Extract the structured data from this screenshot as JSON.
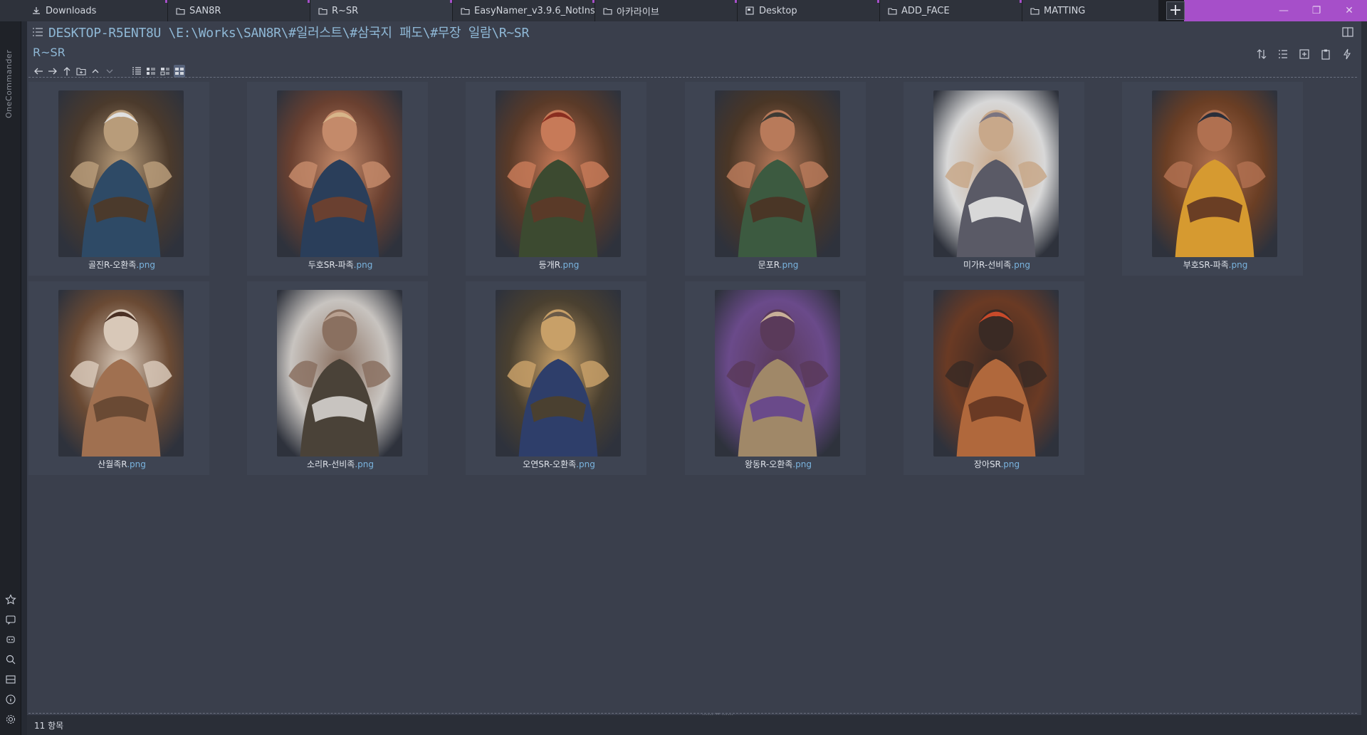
{
  "tabs": [
    {
      "label": "Downloads",
      "icon": "download-icon"
    },
    {
      "label": "SAN8R",
      "icon": "folder-icon"
    },
    {
      "label": "R~SR",
      "icon": "folder-icon"
    },
    {
      "label": "EasyNamer_v3.9.6_NotIns…",
      "icon": "folder-icon"
    },
    {
      "label": "아카라이브",
      "icon": "folder-icon"
    },
    {
      "label": "Desktop",
      "icon": "desktop-icon"
    },
    {
      "label": "ADD_FACE",
      "icon": "folder-icon"
    },
    {
      "label": "MATTING",
      "icon": "folder-icon"
    }
  ],
  "app_name": "OneCommander",
  "path": "DESKTOP-R5ENT8U \\E:\\Works\\SAN8R\\#일러스트\\#삼국지 패도\\#무장 일람\\R~SR",
  "folder_title": "R~SR",
  "files": [
    {
      "name": "골진R-오환족",
      "ext": ".png",
      "palette": [
        "#4b3a2c",
        "#2e4a66",
        "#b89c7a",
        "#e0e0e0"
      ]
    },
    {
      "name": "두호SR-파족",
      "ext": ".png",
      "palette": [
        "#6a4030",
        "#2a3e5a",
        "#c48a6a",
        "#d7b58a"
      ]
    },
    {
      "name": "등개R",
      "ext": ".png",
      "palette": [
        "#5a3a28",
        "#3c4a30",
        "#c77a58",
        "#8a2e20"
      ]
    },
    {
      "name": "문포R",
      "ext": ".png",
      "palette": [
        "#4a3626",
        "#3c5a40",
        "#b87a5a",
        "#3e3a34"
      ]
    },
    {
      "name": "미가R-선비족",
      "ext": ".png",
      "palette": [
        "#d8d8d8",
        "#5a5a66",
        "#c8a88a",
        "#7a7480"
      ]
    },
    {
      "name": "부호SR-파족",
      "ext": ".png",
      "palette": [
        "#6a3e24",
        "#d69a30",
        "#b07050",
        "#2a2e3a"
      ]
    },
    {
      "name": "산월족R",
      "ext": ".png",
      "palette": [
        "#6a4a34",
        "#a07050",
        "#d8c8b8",
        "#4a3024"
      ]
    },
    {
      "name": "소리R-선비족",
      "ext": ".png",
      "palette": [
        "#c8c4c0",
        "#4a4238",
        "#8a7060",
        "#b8a090"
      ]
    },
    {
      "name": "오연SR-오환족",
      "ext": ".png",
      "palette": [
        "#4a4030",
        "#2e3e6a",
        "#c8a068",
        "#6a5a48"
      ]
    },
    {
      "name": "왕동R-오환족",
      "ext": ".png",
      "palette": [
        "#6a4a8a",
        "#a08868",
        "#5a3a5a",
        "#c8b098"
      ]
    },
    {
      "name": "장아SR",
      "ext": ".png",
      "palette": [
        "#6a3a24",
        "#b0683c",
        "#3a2a24",
        "#c84a2a"
      ]
    }
  ],
  "status": {
    "item_count": "11 항목"
  },
  "nav_icons": [
    "back-arrow-icon",
    "forward-arrow-icon",
    "up-arrow-icon",
    "new-folder-icon",
    "chevron-up-icon",
    "chevron-down-icon",
    "list-view-icon",
    "details-view-icon",
    "tiles-view-icon",
    "thumbnails-view-icon"
  ],
  "right_tool_icons": [
    "sort-icon",
    "columns-icon",
    "new-item-icon",
    "clipboard-icon",
    "flash-icon"
  ],
  "left_sidebar_icons": [
    "star-icon",
    "chat-icon",
    "robot-icon",
    "search-icon",
    "panel-icon",
    "info-icon",
    "gear-icon"
  ],
  "colors": {
    "accent": "#a64fc9",
    "path": "#8fb8d6",
    "extension": "#7ab4df",
    "panel": "#3a3f4c"
  }
}
